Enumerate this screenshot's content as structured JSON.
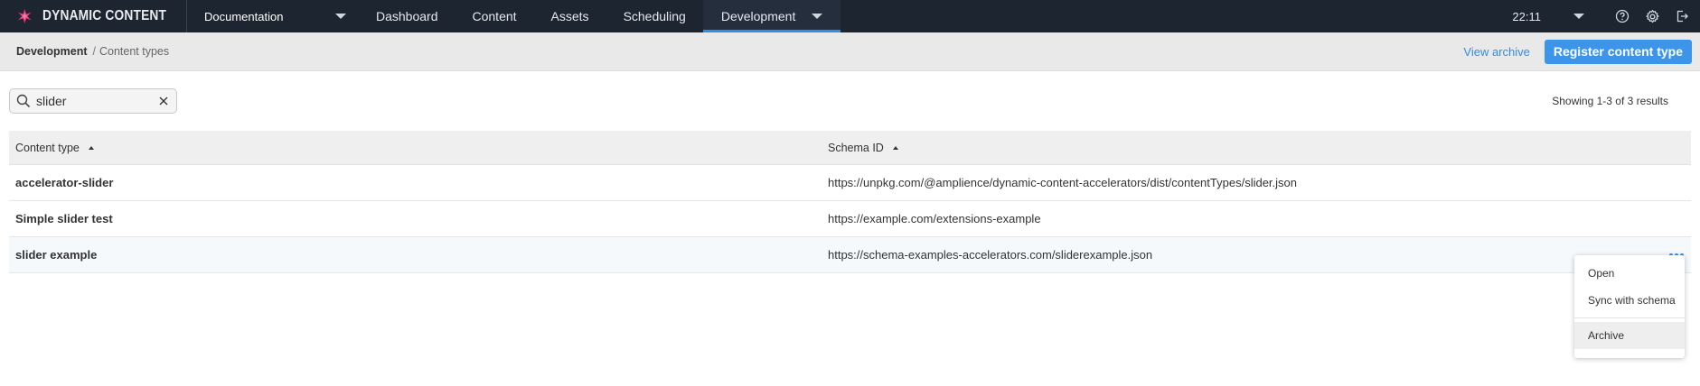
{
  "brand": {
    "name": "DYNAMIC CONTENT"
  },
  "topbar": {
    "hub": "Documentation",
    "nav": [
      "Dashboard",
      "Content",
      "Assets",
      "Scheduling"
    ],
    "active_nav": "Development",
    "time": "22:11"
  },
  "breadcrumb": {
    "root": "Development",
    "separator": "/",
    "current": "Content types"
  },
  "actions": {
    "view_archive": "View archive",
    "register": "Register content type"
  },
  "search": {
    "value": "slider"
  },
  "results": {
    "text": "Showing 1-3 of 3 results"
  },
  "table": {
    "headers": {
      "type": "Content type",
      "schema": "Schema ID"
    },
    "rows": [
      {
        "type": "accelerator-slider",
        "schema": "https://unpkg.com/@amplience/dynamic-content-accelerators/dist/contentTypes/slider.json"
      },
      {
        "type": "Simple slider test",
        "schema": "https://example.com/extensions-example"
      },
      {
        "type": "slider example",
        "schema": "https://schema-examples-accelerators.com/sliderexample.json"
      }
    ]
  },
  "context_menu": {
    "items": [
      "Open",
      "Sync with schema"
    ],
    "archive": "Archive"
  },
  "icons": {
    "logo": "dynamic-content-logo",
    "help": "help-icon",
    "settings": "gear-icon",
    "logout": "logout-icon",
    "search": "search-icon",
    "clear": "close-icon",
    "more": "more-icon"
  },
  "colors": {
    "topbar": "#1d2531",
    "accent": "#2d8ef0",
    "primary_button": "#3d95ea",
    "logo": "#d8356f"
  }
}
